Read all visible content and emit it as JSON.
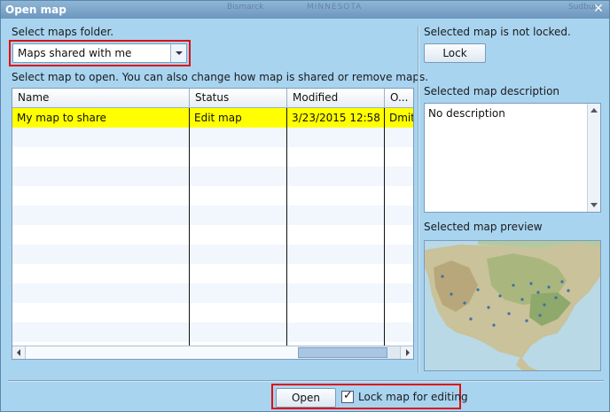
{
  "window": {
    "title": "Open map",
    "map_bg_labels": [
      "Bismarck",
      "MINNESOTA",
      "Sudbury"
    ]
  },
  "folder": {
    "label": "Select maps folder.",
    "selected": "Maps shared with me"
  },
  "instructions": "Select map to open. You can also change how map is shared or remove maps.",
  "table": {
    "columns": [
      "Name",
      "Status",
      "Modified",
      "O..."
    ],
    "rows": [
      {
        "name": "My map to share",
        "status": "Edit map",
        "modified": "3/23/2015 12:58",
        "owner": "Dmit"
      }
    ]
  },
  "lock_panel": {
    "status_text": "Selected map is not locked.",
    "lock_label": "Lock"
  },
  "description": {
    "label": "Selected map description",
    "text": "No description"
  },
  "preview": {
    "label": "Selected map preview"
  },
  "footer": {
    "open_label": "Open",
    "lock_checkbox_label": "Lock map for editing",
    "lock_checked": true
  },
  "colors": {
    "selected_row": "#ffff00",
    "highlight_border": "#e01010",
    "dialog_bg": "#a8d4f0"
  }
}
